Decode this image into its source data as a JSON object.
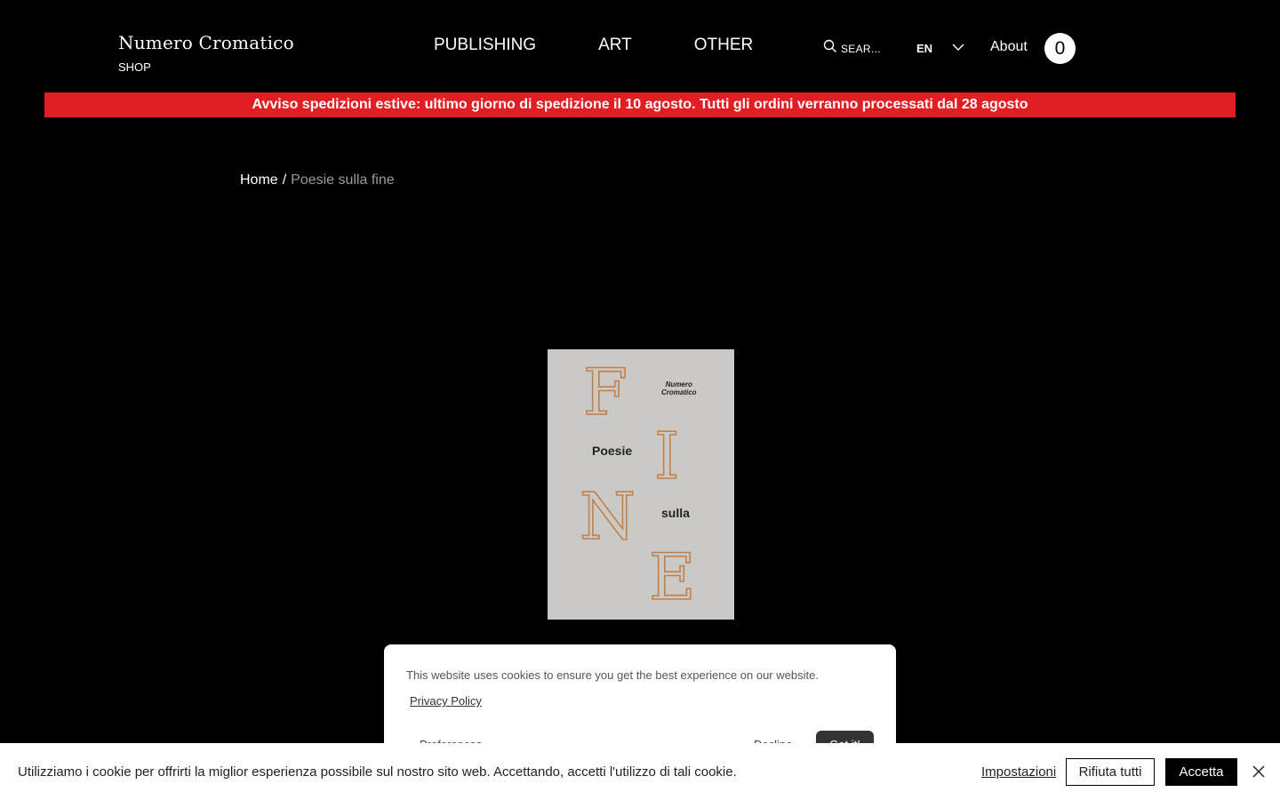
{
  "header": {
    "brand_name": "Numero Cromatico",
    "brand_sub": "SHOP",
    "nav": [
      {
        "label": "PUBLISHING"
      },
      {
        "label": "ART"
      },
      {
        "label": "OTHER"
      }
    ],
    "search_placeholder": "SEAR...",
    "language": "EN",
    "about_label": "About",
    "cart_count": "0"
  },
  "notice": {
    "text": "Avviso spedizioni estive: ultimo giorno di spedizione il 10 agosto. Tutti gli ordini verranno processati dal 28 agosto",
    "color": "#e01e24"
  },
  "breadcrumb": {
    "home": "Home",
    "separator": "/",
    "current": "Poesie sulla fine"
  },
  "product": {
    "cover": {
      "letters": [
        "F",
        "I",
        "N",
        "E"
      ],
      "publisher_line1": "Numero",
      "publisher_line2": "Cromatico",
      "word1": "Poesie",
      "word2": "sulla",
      "background_color": "#cbc9c6",
      "letter_color": "#c0804a"
    }
  },
  "cookie_card": {
    "text": "This website uses cookies to ensure you get the best experience on our website.",
    "privacy_link": "Privacy Policy",
    "preferences_label": "Preferences",
    "decline_label": "Decline",
    "accept_label": "Got it!"
  },
  "cookie_bar": {
    "text": "Utilizziamo i cookie per offrirti la miglior esperienza possibile sul nostro sito web. Accettando, accetti l'utilizzo di tali cookie.",
    "settings_label": "Impostazioni",
    "reject_label": "Rifiuta tutti",
    "accept_label": "Accetta"
  }
}
